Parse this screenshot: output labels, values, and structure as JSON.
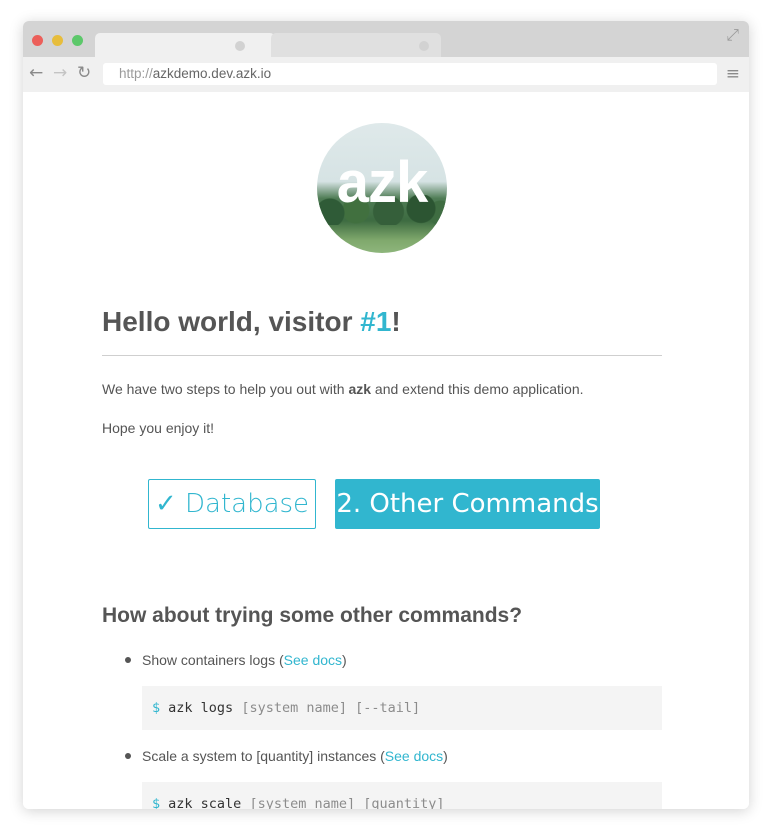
{
  "browser": {
    "url_scheme": "http://",
    "url_host": "azkdemo.dev.azk.io",
    "icons": {
      "back": "back-arrow-icon",
      "forward": "forward-arrow-icon",
      "reload": "reload-icon",
      "menu": "hamburger-menu-icon",
      "fullscreen": "fullscreen-icon"
    }
  },
  "logo": {
    "text": "azk"
  },
  "heading": {
    "prefix": "Hello world, visitor ",
    "visitor": "#1",
    "suffix": "!"
  },
  "intro": {
    "line1_before": "We have two steps to help you out with ",
    "line1_bold": "azk",
    "line1_after": " and extend this demo application.",
    "line2": "Hope you enjoy it!"
  },
  "buttons": {
    "database": "✓ Database",
    "commands": "2. Other Commands"
  },
  "section": {
    "title": "How about trying some other commands?",
    "items": [
      {
        "text_before": "Show containers logs (",
        "link": "See docs",
        "text_after": ")",
        "code": {
          "prompt": "$",
          "cmd": "azk logs",
          "args": "[system name] [--tail]"
        }
      },
      {
        "text_before": "Scale a system to [quantity] instances (",
        "link": "See docs",
        "text_after": ")",
        "code": {
          "prompt": "$",
          "cmd": "azk scale",
          "args": "[system name] [quantity]"
        }
      }
    ]
  },
  "colors": {
    "accent": "#31b6cf",
    "text": "#555555",
    "code_bg": "#f4f4f4"
  }
}
